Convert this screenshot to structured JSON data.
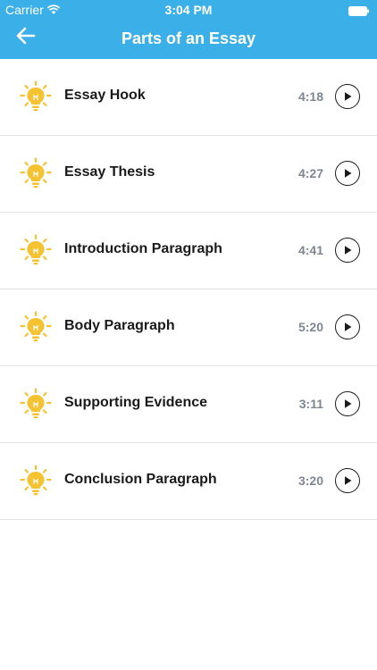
{
  "status_bar": {
    "carrier": "Carrier",
    "time": "3:04 PM",
    "wifi_icon": "wifi-icon",
    "battery_icon": "battery-icon"
  },
  "header": {
    "title": "Parts of an Essay",
    "back_icon": "arrow-left-icon",
    "background_color": "#3aafe8"
  },
  "items": [
    {
      "title": "Essay Hook",
      "duration": "4:18",
      "icon": "lightbulb-icon",
      "action_icon": "play-icon"
    },
    {
      "title": "Essay Thesis",
      "duration": "4:27",
      "icon": "lightbulb-icon",
      "action_icon": "play-icon"
    },
    {
      "title": "Introduction Paragraph",
      "duration": "4:41",
      "icon": "lightbulb-icon",
      "action_icon": "play-icon"
    },
    {
      "title": "Body Paragraph",
      "duration": "5:20",
      "icon": "lightbulb-icon",
      "action_icon": "play-icon"
    },
    {
      "title": "Supporting Evidence",
      "duration": "3:11",
      "icon": "lightbulb-icon",
      "action_icon": "play-icon"
    },
    {
      "title": "Conclusion Paragraph",
      "duration": "3:20",
      "icon": "lightbulb-icon",
      "action_icon": "play-icon"
    }
  ],
  "colors": {
    "accent": "#3aafe8",
    "bulb": "#f5c232",
    "duration_text": "#7e8790"
  }
}
